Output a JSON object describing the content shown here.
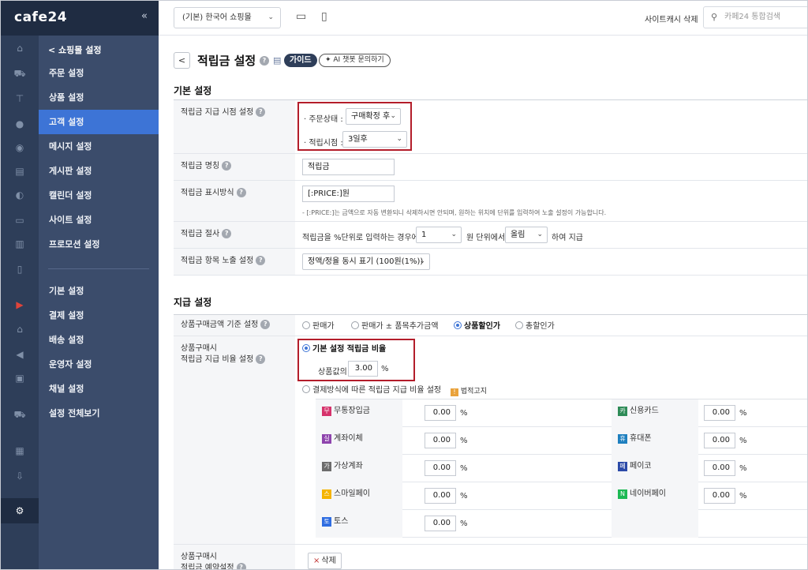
{
  "app": {
    "brand": "cafe24",
    "collapse_icon": "«"
  },
  "rail_icons": [
    "home-icon",
    "cart-icon",
    "shirt-icon",
    "person-icon",
    "chat-icon",
    "board-icon",
    "palette-icon",
    "display-icon",
    "chart-icon",
    "mobile-icon",
    "video-icon",
    "store-icon",
    "megaphone-icon",
    "ad-icon",
    "truck-icon",
    "apps-icon",
    "download-icon",
    "gear-icon"
  ],
  "menu": {
    "back_label": "< 쇼핑몰 설정",
    "items": [
      "주문 설정",
      "상품 설정",
      "고객 설정",
      "메시지 설정",
      "게시판 설정",
      "캘린더 설정",
      "사이트 설정",
      "프로모션 설정"
    ],
    "items2": [
      "기본 설정",
      "결제 설정",
      "배송 설정",
      "운영자 설정",
      "채널 설정",
      "설정 전체보기"
    ],
    "active": "고객 설정"
  },
  "topbar": {
    "shop_select": "(기본) 한국어 쇼핑몰",
    "cache_delete": "사이트캐시 삭제",
    "search_placeholder": "카페24 통합검색"
  },
  "page": {
    "back": "<",
    "title": "적립금 설정",
    "help": "?",
    "guide": "가이드",
    "ai_chat": "✦ AI 챗봇 문의하기"
  },
  "basic": {
    "section_title": "기본 설정",
    "timing": {
      "label": "적립금 지급 시점 설정",
      "order_status_label": "· 주문상태 :",
      "order_status_value": "구매확정 후",
      "reserve_point_label": "· 적립시점 :",
      "reserve_point_value": "3일후"
    },
    "name": {
      "label": "적립금 명칭",
      "value": "적립금"
    },
    "display": {
      "label": "적립금 표시방식",
      "value": "[:PRICE:]원",
      "note": "- [:PRICE:]는 금액으로 자동 변환되니 삭제하시면 안되며, 원하는 위치에 단위를 입력하여 노출 설정이 가능합니다."
    },
    "rounding": {
      "label": "적립금 절사",
      "text_before": "적립금을 %단위로 입력하는 경우에",
      "unit_value": "1",
      "text_middle": "원 단위에서",
      "method_value": "올림",
      "text_after": "하여 지급"
    },
    "item_display": {
      "label": "적립금 항목 노출 설정",
      "value": "정액/정율 동시 표기 (100원(1%))"
    }
  },
  "payment": {
    "section_title": "지급 설정",
    "basis": {
      "label": "상품구매금액 기준 설정",
      "options": [
        "판매가",
        "판매가 ± 품목추가금액",
        "상품할인가",
        "총할인가"
      ],
      "selected": "상품할인가"
    },
    "rate": {
      "label_line1": "상품구매시",
      "label_line2": "적립금 지급 비율 설정",
      "default_option": "기본 설정 적립금 비율",
      "product_price_label": "상품값의",
      "product_rate": "3.00",
      "percent": "%",
      "method_option": "결제방식에 따른 적립금 지급 비율 설정",
      "legal_notice": "법적고지",
      "methods_left": [
        {
          "badge": "무",
          "name": "무통장입금",
          "value": "0.00",
          "color": "#d6336c"
        },
        {
          "badge": "실",
          "name": "계좌이체",
          "value": "0.00",
          "color": "#8e44ad"
        },
        {
          "badge": "가",
          "name": "가상계좌",
          "value": "0.00",
          "color": "#6c6c6c"
        },
        {
          "badge": "스",
          "name": "스마일페이",
          "value": "0.00",
          "color": "#f5b400"
        },
        {
          "badge": "토",
          "name": "토스",
          "value": "0.00",
          "color": "#2f6de1"
        }
      ],
      "methods_right": [
        {
          "badge": "카",
          "name": "신용카드",
          "value": "0.00",
          "color": "#2e8b57"
        },
        {
          "badge": "휴",
          "name": "휴대폰",
          "value": "0.00",
          "color": "#1e7fbf"
        },
        {
          "badge": "페",
          "name": "페이코",
          "value": "0.00",
          "color": "#2b4aa8"
        },
        {
          "badge": "N",
          "name": "네이버페이",
          "value": "0.00",
          "color": "#1db954"
        }
      ]
    },
    "reserve": {
      "label_line1": "상품구매시",
      "label_line2": "적립금 예약설정",
      "delete_label": "삭제"
    }
  }
}
